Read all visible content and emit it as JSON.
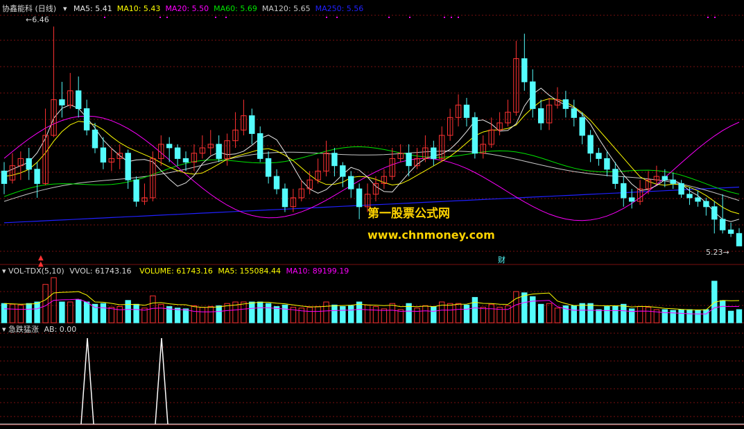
{
  "colors": {
    "background": "#000000",
    "grid": "#7a1010",
    "up_candle": "#ff3232",
    "down_candle": "#54fcfc",
    "ma5": "#e8e8e8",
    "ma10": "#ffff00",
    "ma20": "#ff00ff",
    "ma60": "#00e600",
    "ma120": "#c8c8c8",
    "ma250": "#2020ff",
    "label": "#c8c8c8",
    "vol_line": "#ff4040",
    "watermark": "#ffd400",
    "indicator_line": "#ffffff"
  },
  "main_panel": {
    "title": "协鑫能科 (日线)",
    "indicators": [
      {
        "label": "MA5: 5.41",
        "color": "#e8e8e8"
      },
      {
        "label": "MA10: 5.43",
        "color": "#ffff00"
      },
      {
        "label": "MA20: 5.50",
        "color": "#ff00ff"
      },
      {
        "label": "MA60: 5.69",
        "color": "#00e600"
      },
      {
        "label": "MA120: 5.65",
        "color": "#c8c8c8"
      },
      {
        "label": "MA250: 5.56",
        "color": "#2020ff"
      }
    ],
    "high_marker": "6.46",
    "low_marker": "5.23",
    "event_marker": "财",
    "event_icon": "double-up-arrow-icon",
    "watermark_line1": "第一股票公式网",
    "watermark_line2": "www.chnmoney.com"
  },
  "volume_panel": {
    "title": "VOL-TDX(5,10)",
    "vvol": "VVOL: 61743.16",
    "volume": "VOLUME: 61743.16",
    "ma5": "MA5: 155084.44",
    "ma10": "MA10: 89199.19"
  },
  "indicator_panel": {
    "title": "急跌猛涨",
    "ab": "AB: 0.00"
  },
  "chart_data": {
    "type": "candlestick",
    "y_range_main": [
      5.2,
      6.5
    ],
    "grid": true,
    "price_high": 6.46,
    "price_low": 5.23,
    "candles": [
      [
        5.65,
        5.58,
        5.7,
        5.52
      ],
      [
        5.6,
        5.68,
        5.75,
        5.58
      ],
      [
        5.68,
        5.72,
        5.76,
        5.6
      ],
      [
        5.72,
        5.66,
        5.78,
        5.6
      ],
      [
        5.66,
        5.58,
        5.7,
        5.5
      ],
      [
        5.58,
        5.85,
        6.0,
        5.57
      ],
      [
        5.85,
        6.05,
        6.46,
        5.84
      ],
      [
        6.05,
        6.02,
        6.15,
        5.95
      ],
      [
        6.02,
        6.1,
        6.2,
        6.0
      ],
      [
        6.1,
        6.0,
        6.18,
        5.95
      ],
      [
        6.0,
        5.88,
        6.05,
        5.85
      ],
      [
        5.88,
        5.78,
        5.92,
        5.75
      ],
      [
        5.78,
        5.7,
        5.84,
        5.66
      ],
      [
        5.7,
        5.72,
        5.78,
        5.65
      ],
      [
        5.72,
        5.75,
        5.8,
        5.66
      ],
      [
        5.75,
        5.6,
        5.77,
        5.55
      ],
      [
        5.6,
        5.48,
        5.62,
        5.45
      ],
      [
        5.48,
        5.5,
        5.58,
        5.46
      ],
      [
        5.5,
        5.72,
        5.76,
        5.48
      ],
      [
        5.72,
        5.8,
        5.85,
        5.68
      ],
      [
        5.8,
        5.78,
        5.84,
        5.7
      ],
      [
        5.78,
        5.72,
        5.8,
        5.68
      ],
      [
        5.72,
        5.7,
        5.76,
        5.65
      ],
      [
        5.7,
        5.75,
        5.8,
        5.65
      ],
      [
        5.75,
        5.78,
        5.85,
        5.72
      ],
      [
        5.78,
        5.8,
        5.88,
        5.74
      ],
      [
        5.8,
        5.72,
        5.85,
        5.7
      ],
      [
        5.72,
        5.82,
        5.86,
        5.68
      ],
      [
        5.82,
        5.88,
        5.98,
        5.78
      ],
      [
        5.88,
        5.96,
        6.05,
        5.85
      ],
      [
        5.96,
        5.86,
        6.0,
        5.8
      ],
      [
        5.86,
        5.72,
        5.9,
        5.7
      ],
      [
        5.72,
        5.62,
        5.76,
        5.58
      ],
      [
        5.62,
        5.55,
        5.66,
        5.52
      ],
      [
        5.55,
        5.45,
        5.58,
        5.42
      ],
      [
        5.45,
        5.5,
        5.55,
        5.42
      ],
      [
        5.5,
        5.55,
        5.6,
        5.48
      ],
      [
        5.55,
        5.6,
        5.65,
        5.52
      ],
      [
        5.6,
        5.65,
        5.72,
        5.58
      ],
      [
        5.65,
        5.75,
        5.82,
        5.62
      ],
      [
        5.75,
        5.68,
        5.78,
        5.62
      ],
      [
        5.68,
        5.62,
        5.7,
        5.56
      ],
      [
        5.62,
        5.55,
        5.65,
        5.5
      ],
      [
        5.55,
        5.45,
        5.58,
        5.38
      ],
      [
        5.45,
        5.52,
        5.58,
        5.42
      ],
      [
        5.52,
        5.58,
        5.62,
        5.48
      ],
      [
        5.58,
        5.62,
        5.66,
        5.55
      ],
      [
        5.62,
        5.72,
        5.78,
        5.6
      ],
      [
        5.72,
        5.75,
        5.8,
        5.7
      ],
      [
        5.75,
        5.68,
        5.8,
        5.62
      ],
      [
        5.68,
        5.72,
        5.78,
        5.66
      ],
      [
        5.72,
        5.78,
        5.85,
        5.7
      ],
      [
        5.78,
        5.72,
        5.82,
        5.68
      ],
      [
        5.72,
        5.85,
        5.9,
        5.7
      ],
      [
        5.85,
        5.95,
        6.0,
        5.82
      ],
      [
        5.95,
        6.02,
        6.08,
        5.9
      ],
      [
        6.02,
        5.95,
        6.06,
        5.9
      ],
      [
        5.95,
        5.75,
        5.98,
        5.72
      ],
      [
        5.75,
        5.8,
        5.85,
        5.72
      ],
      [
        5.8,
        5.88,
        5.95,
        5.78
      ],
      [
        5.88,
        5.92,
        5.98,
        5.85
      ],
      [
        5.92,
        5.98,
        6.05,
        5.9
      ],
      [
        5.98,
        6.28,
        6.38,
        5.96
      ],
      [
        6.28,
        6.15,
        6.42,
        6.1
      ],
      [
        6.15,
        6.0,
        6.22,
        5.95
      ],
      [
        6.0,
        5.92,
        6.05,
        5.88
      ],
      [
        5.92,
        6.02,
        6.06,
        5.88
      ],
      [
        6.02,
        6.05,
        6.12,
        6.0
      ],
      [
        6.05,
        6.0,
        6.1,
        5.95
      ],
      [
        6.0,
        5.95,
        6.05,
        5.9
      ],
      [
        5.95,
        5.85,
        5.98,
        5.8
      ],
      [
        5.85,
        5.75,
        5.88,
        5.7
      ],
      [
        5.75,
        5.72,
        5.78,
        5.68
      ],
      [
        5.72,
        5.66,
        5.76,
        5.62
      ],
      [
        5.66,
        5.58,
        5.7,
        5.55
      ],
      [
        5.58,
        5.5,
        5.62,
        5.45
      ],
      [
        5.5,
        5.48,
        5.55,
        5.44
      ],
      [
        5.48,
        5.55,
        5.6,
        5.46
      ],
      [
        5.55,
        5.6,
        5.65,
        5.52
      ],
      [
        5.6,
        5.62,
        5.68,
        5.58
      ],
      [
        5.62,
        5.6,
        5.66,
        5.56
      ],
      [
        5.6,
        5.58,
        5.64,
        5.55
      ],
      [
        5.58,
        5.52,
        5.6,
        5.5
      ],
      [
        5.52,
        5.5,
        5.56,
        5.46
      ],
      [
        5.5,
        5.48,
        5.54,
        5.45
      ],
      [
        5.48,
        5.45,
        5.5,
        5.4
      ],
      [
        5.45,
        5.38,
        5.48,
        5.3
      ],
      [
        5.38,
        5.32,
        5.52,
        5.3
      ],
      [
        5.32,
        5.3,
        5.36,
        5.28
      ],
      [
        5.3,
        5.23,
        5.33,
        5.23
      ]
    ],
    "ma_lines": {
      "MA5": [
        5.64,
        5.67,
        5.7,
        5.78,
        5.95,
        6.03,
        6.0,
        5.92,
        5.82,
        5.75,
        5.7,
        5.72,
        5.7,
        5.62,
        5.56,
        5.6,
        5.7,
        5.76,
        5.74,
        5.75,
        5.8,
        5.86,
        5.82,
        5.7,
        5.58,
        5.52,
        5.55,
        5.62,
        5.68,
        5.63,
        5.55,
        5.52,
        5.6,
        5.68,
        5.73,
        5.74,
        5.78,
        5.86,
        5.95,
        5.92,
        5.86,
        5.9,
        6.05,
        6.12,
        6.06,
        6.02,
        6.0,
        5.92,
        5.8,
        5.7,
        5.6,
        5.54,
        5.55,
        5.6,
        5.6,
        5.54,
        5.5,
        5.42,
        5.36,
        5.38
      ],
      "MA10": [
        5.62,
        5.63,
        5.66,
        5.72,
        5.82,
        5.9,
        5.93,
        5.92,
        5.88,
        5.82,
        5.78,
        5.75,
        5.72,
        5.68,
        5.65,
        5.63,
        5.64,
        5.68,
        5.72,
        5.74,
        5.76,
        5.78,
        5.76,
        5.72,
        5.66,
        5.6,
        5.57,
        5.58,
        5.62,
        5.62,
        5.6,
        5.57,
        5.58,
        5.62,
        5.66,
        5.7,
        5.74,
        5.8,
        5.86,
        5.88,
        5.88,
        5.9,
        5.98,
        6.04,
        6.06,
        6.04,
        6.0,
        5.94,
        5.86,
        5.78,
        5.7,
        5.62,
        5.58,
        5.57,
        5.58,
        5.56,
        5.53,
        5.48,
        5.43,
        5.41
      ]
    },
    "volume_ma": {
      "MA5": 155084.44,
      "MA10": 89199.19,
      "last_volume": 61743.16
    },
    "indicator_peaks": 2
  }
}
